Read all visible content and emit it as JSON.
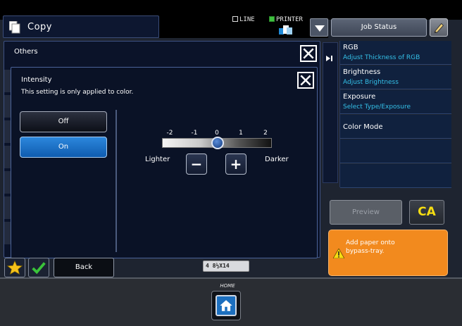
{
  "header": {
    "mode_title": "Copy",
    "line_label": "LINE",
    "printer_label": "PRINTER",
    "job_status_label": "Job Status"
  },
  "right_panel": {
    "items": [
      {
        "title": "RGB",
        "subtitle": "Adjust Thickness of RGB"
      },
      {
        "title": "Brightness",
        "subtitle": "Adjust Brightness"
      },
      {
        "title": "Exposure",
        "subtitle": "Select Type/Exposure"
      },
      {
        "title": "Color Mode",
        "subtitle": ""
      }
    ]
  },
  "actions": {
    "preview_label": "Preview",
    "ca_label": "CA",
    "back_label": "Back"
  },
  "alert": {
    "line1": "Add paper onto",
    "line2": "bypass-tray."
  },
  "paper": {
    "indicator": "4 8½X14"
  },
  "home": {
    "label": "HOME"
  },
  "others_dialog": {
    "title": "Others"
  },
  "intensity_dialog": {
    "title": "Intensity",
    "subtitle": "This setting is only applied to color.",
    "off_label": "Off",
    "on_label": "On",
    "selected": "On",
    "ticks": [
      "-2",
      "-1",
      "0",
      "1",
      "2"
    ],
    "value": 0,
    "lighter_label": "Lighter",
    "darker_label": "Darker",
    "minus_glyph": "−",
    "plus_glyph": "+"
  },
  "colors": {
    "accent_blue": "#1c6fbf",
    "ca_yellow": "#f6dd12",
    "alert_orange": "#f28a1e",
    "subtitle_cyan": "#34c0e8"
  }
}
